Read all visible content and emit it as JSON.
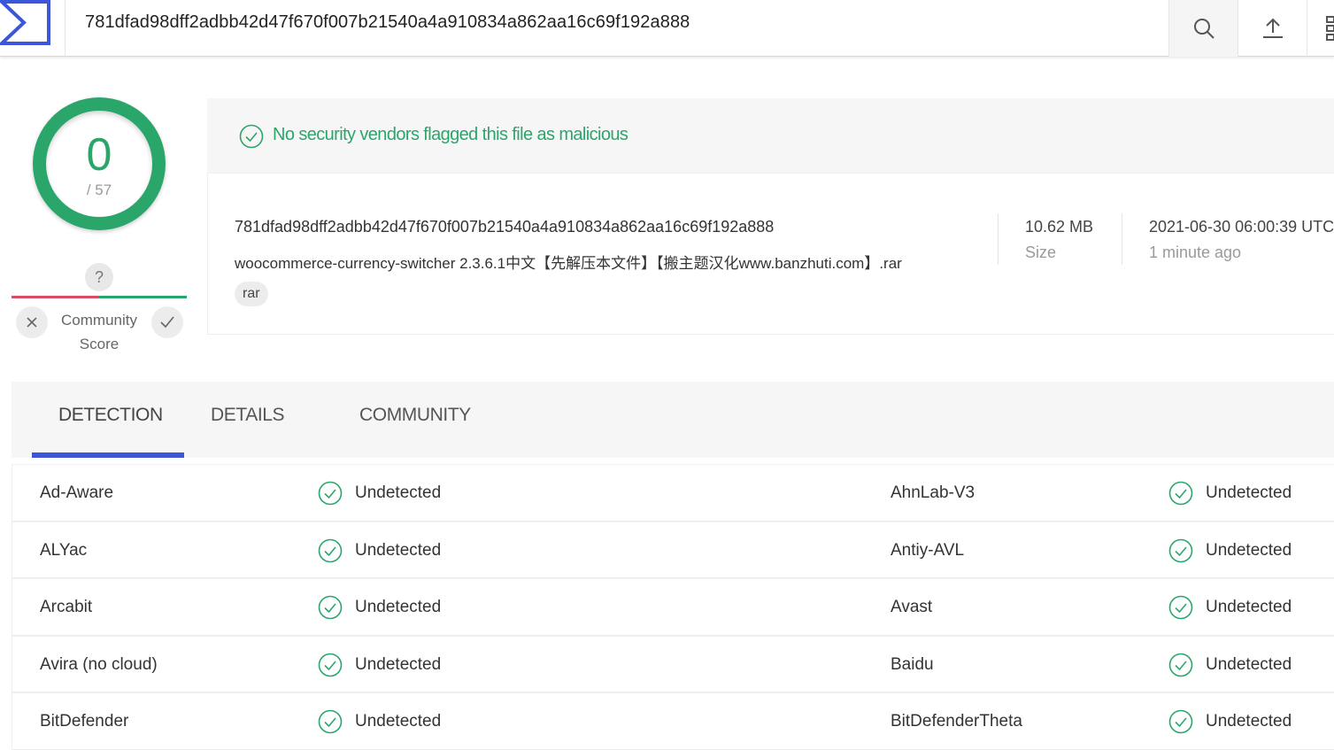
{
  "header": {
    "search_value": "781dfad98dff2adbb42d47f670f007b21540a4a910834a862aa16c69f192a888"
  },
  "score": {
    "detections": "0",
    "total": "/ 57"
  },
  "community_score": {
    "value": "?",
    "label": "Community Score"
  },
  "verdict": {
    "text": "No security vendors flagged this file as malicious"
  },
  "file": {
    "hash": "781dfad98dff2adbb42d47f670f007b21540a4a910834a862aa16c69f192a888",
    "name": "woocommerce-currency-switcher 2.3.6.1中文【先解压本文件】【搬主题汉化www.banzhuti.com】.rar",
    "tag": "rar",
    "size_value": "10.62 MB",
    "size_label": "Size",
    "date_value": "2021-06-30 06:00:39 UTC",
    "date_label": "1 minute ago"
  },
  "tabs": [
    {
      "label": "DETECTION"
    },
    {
      "label": "DETAILS"
    },
    {
      "label": "COMMUNITY"
    }
  ],
  "detections": [
    {
      "left_engine": "Ad-Aware",
      "left_result": "Undetected",
      "right_engine": "AhnLab-V3",
      "right_result": "Undetected"
    },
    {
      "left_engine": "ALYac",
      "left_result": "Undetected",
      "right_engine": "Antiy-AVL",
      "right_result": "Undetected"
    },
    {
      "left_engine": "Arcabit",
      "left_result": "Undetected",
      "right_engine": "Avast",
      "right_result": "Undetected"
    },
    {
      "left_engine": "Avira (no cloud)",
      "left_result": "Undetected",
      "right_engine": "Baidu",
      "right_result": "Undetected"
    },
    {
      "left_engine": "BitDefender",
      "left_result": "Undetected",
      "right_engine": "BitDefenderTheta",
      "right_result": "Undetected"
    }
  ],
  "colors": {
    "clean_green": "#2ba66a",
    "negative_red": "#e04a63",
    "brand_blue": "#3b56d9"
  },
  "icons": {
    "logo": "virustotal-logo",
    "search": "search-icon",
    "upload": "upload-icon",
    "more": "grid-menu-icon",
    "clean": "check-circle-icon"
  }
}
